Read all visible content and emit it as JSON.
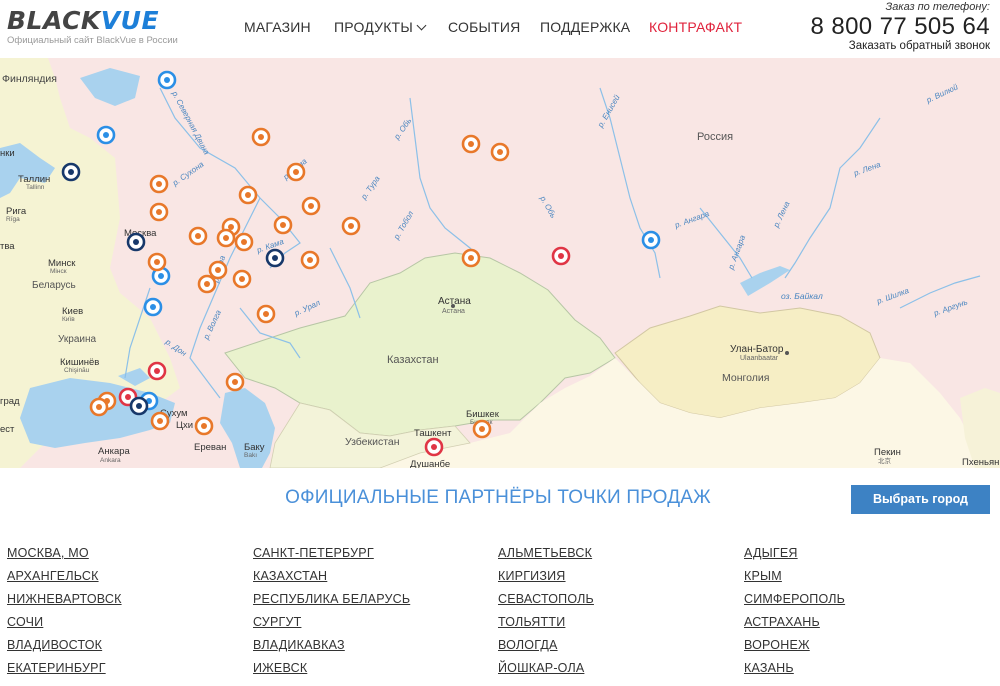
{
  "header": {
    "logo_text_black": "BLACK",
    "logo_text_blue": "VUE",
    "logo_subtitle": "Официальный сайт BlackVue в России",
    "nav": [
      {
        "label": "МАГАЗИН",
        "color": "#333333"
      },
      {
        "label": "ПРОДУКТЫ",
        "color": "#333333",
        "has_dropdown": true
      },
      {
        "label": "СОБЫТИЯ",
        "color": "#333333"
      },
      {
        "label": "ПОДДЕРЖКА",
        "color": "#333333"
      },
      {
        "label": "КОНТРАФАКТ",
        "color": "#e0233c"
      }
    ],
    "phone_caption": "Заказ по телефону:",
    "phone_number": "8 800 77 505 64",
    "callback_label": "Заказать обратный звонок"
  },
  "map": {
    "labels": {
      "finland": "Финляндия",
      "russia": "Россия",
      "kazakhstan": "Казахстан",
      "mongolia": "Монголия",
      "uzbekistan": "Узбекистан",
      "belarus": "Беларусь",
      "ukraine": "Украина",
      "astana": "Астана",
      "astana_sub": "Астана",
      "ulanbator": "Улан-Батор",
      "ulanbator_sub": "Ulaanbaatar",
      "tallinn": "Таллин",
      "tallinn_sub": "Tallinn",
      "riga": "Рига",
      "riga_sub": "Rīga",
      "minsk": "Минск",
      "minsk_sub": "Мінск",
      "kiev": "Киев",
      "kiev_sub": "Київ",
      "chisinau": "Кишинёв",
      "chisinau_sub": "Chişinău",
      "moscow": "Москва",
      "bishkek": "Бишкек",
      "bishkek_sub": "Бишкек",
      "tashkent": "Ташкент",
      "dushanbe": "Душанбе",
      "ankara": "Анкара",
      "ankara_sub": "Ankara",
      "erevan": "Ереван",
      "baku": "Баку",
      "baku_sub": "Bakı",
      "sukhum": "Сухум",
      "tskhinval": "Цхи",
      "beijing": "Пекин",
      "beijing_sub": "北京",
      "pkhenyan": "Пхеньян",
      "helsinki_part": "нки",
      "vilnius_part": "тва",
      "grad_part": "град",
      "bukarest_part": "ест",
      "baikal": "оз. Байкал"
    },
    "rivers": [
      "р. Северная Двина",
      "р. Сухона",
      "р. Кама",
      "р. Обь",
      "р. Енисей",
      "р. Вилюй",
      "р. Лена",
      "р. Тура",
      "р. Тобол",
      "р. Кама",
      "р. Сура",
      "р. Волга",
      "р. Урал",
      "р. Дон",
      "р. Обь",
      "р. Ангара",
      "р. Лена",
      "р. Ангара",
      "р. Шилка",
      "р. Аргунь"
    ],
    "marker_colors": {
      "orange": "#e8782a",
      "blue": "#2b8fe6",
      "navy": "#17386a",
      "red": "#e03545"
    }
  },
  "partners": {
    "title": "ОФИЦИАЛЬНЫЕ ПАРТНЁРЫ ТОЧКИ ПРОДАЖ",
    "choose_city_label": "Выбрать город",
    "columns": [
      [
        "Москва, МО",
        "Архангельск",
        "Нижневартовск",
        "Сочи",
        "Владивосток",
        "Екатеринбург"
      ],
      [
        "Санкт-Петербург",
        "Казахстан",
        "Республика Беларусь",
        "Сургут",
        "Владикавказ",
        "Ижевск"
      ],
      [
        "Альметьевск",
        "Киргизия",
        "Севастополь",
        "Тольятти",
        "Вологда",
        "Йошкар-Ола"
      ],
      [
        "Адыгея",
        "Крым",
        "Симферополь",
        "Астрахань",
        "Воронеж",
        "Казань"
      ]
    ]
  }
}
